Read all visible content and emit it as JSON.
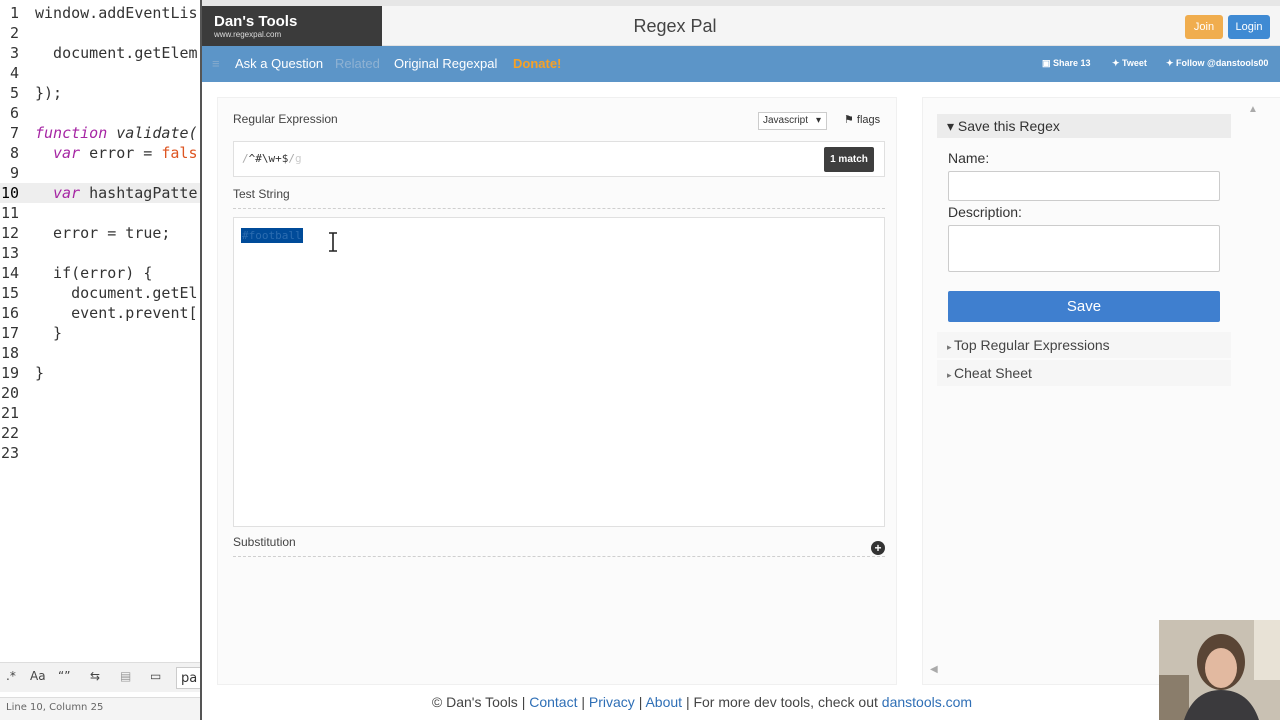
{
  "editor": {
    "line_numbers": [
      "1",
      "2",
      "3",
      "4",
      "5",
      "6",
      "7",
      "8",
      "9",
      "10",
      "11",
      "12",
      "13",
      "14",
      "15",
      "16",
      "17",
      "18",
      "19",
      "20",
      "21",
      "22",
      "23"
    ],
    "lines": {
      "l1": "window.addEventLis",
      "l2": "  document.getElem",
      "l5": "});",
      "l7_kw": "function",
      "l7_rest": " validate(",
      "l8_kw": "var",
      "l8_rest": " error = ",
      "l8_val": "fals",
      "l10_kw": "var",
      "l10_rest": " hashtagPatte",
      "l12": "  error = true;",
      "l14": "  if(error) {",
      "l15": "    document.getEl",
      "l16": "    event.prevent[",
      "l17": "  }",
      "l19": "}"
    },
    "toolbar": {
      "case_label": "Aa",
      "quote_label": "“”",
      "input_value": "pa"
    },
    "status": "Line 10, Column 25"
  },
  "header": {
    "logo_title": "Dan's Tools",
    "logo_sub": "www.regexpal.com",
    "app_title": "Regex Pal",
    "join_label": "Join",
    "login_label": "Login"
  },
  "nav": {
    "ask": "Ask a Question",
    "related": "Related",
    "original": "Original Regexpal",
    "donate": "Donate!",
    "share": "Share 13",
    "tweet": "Tweet",
    "follow": "Follow @danstools00"
  },
  "regex": {
    "section_label": "Regular Expression",
    "language": "Javascript",
    "flags_label": "flags",
    "open_slash": "/",
    "pattern": "^#\\w+$",
    "close_slash": "/",
    "flag_value": "g",
    "match_badge": "1 match"
  },
  "test": {
    "section_label": "Test String",
    "value": "#football"
  },
  "substitution": {
    "section_label": "Substitution"
  },
  "save_panel": {
    "title": "Save this Regex",
    "name_label": "Name:",
    "desc_label": "Description:",
    "save_label": "Save",
    "top_expressions": "Top Regular Expressions",
    "cheat_sheet": "Cheat Sheet"
  },
  "footer": {
    "copyright": "© Dan's Tools |",
    "contact": "Contact",
    "sep1": "|",
    "privacy": "Privacy",
    "sep2": "|",
    "about": "About",
    "more": "| For more dev tools, check out",
    "danstools": "danstools.com"
  },
  "colors": {
    "nav_bg": "#5c95c8",
    "donate": "#f6a126",
    "save_button": "#3f7fcf",
    "join_button": "#f0ad4e",
    "login_button": "#3f8ad3",
    "selection": "#004b99"
  }
}
